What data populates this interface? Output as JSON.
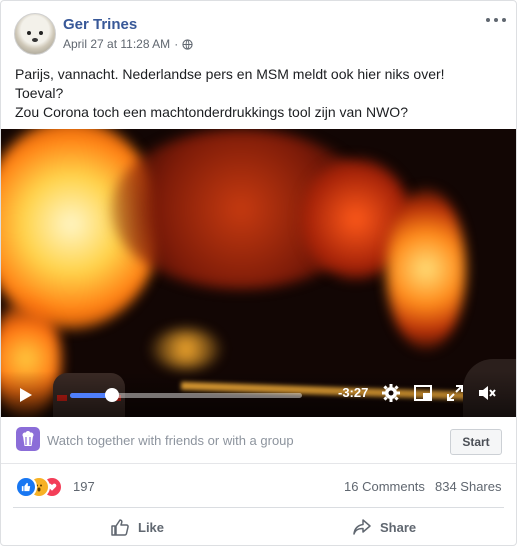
{
  "post": {
    "author": "Ger Trines",
    "timestamp": "April 27 at 11:28 AM",
    "privacy_icon": "globe-icon",
    "text_lines": [
      "Parijs, vannacht. Nederlandse pers en MSM meldt ook hier niks over!",
      "Toeval?",
      "Zou Corona toch een machtonderdrukkings tool zijn van NWO?"
    ]
  },
  "video": {
    "time_remaining": "-3:27",
    "progress": 0.18,
    "controls": [
      "play-icon",
      "gear-icon",
      "miniplayer-icon",
      "fullscreen-icon",
      "mute-icon"
    ]
  },
  "watch_together": {
    "text": "Watch together with friends or with a group",
    "button": "Start"
  },
  "stats": {
    "reaction_count": "197",
    "reactions": [
      "like",
      "wow",
      "love"
    ],
    "comments": "16 Comments",
    "shares": "834 Shares"
  },
  "actions": {
    "like": "Like",
    "share": "Share"
  },
  "colors": {
    "author_link": "#385898",
    "like_blue": "#1877f2",
    "love_red": "#f33e58",
    "wow_yellow": "#f7b125",
    "progress_blue": "#4f7ffa"
  }
}
